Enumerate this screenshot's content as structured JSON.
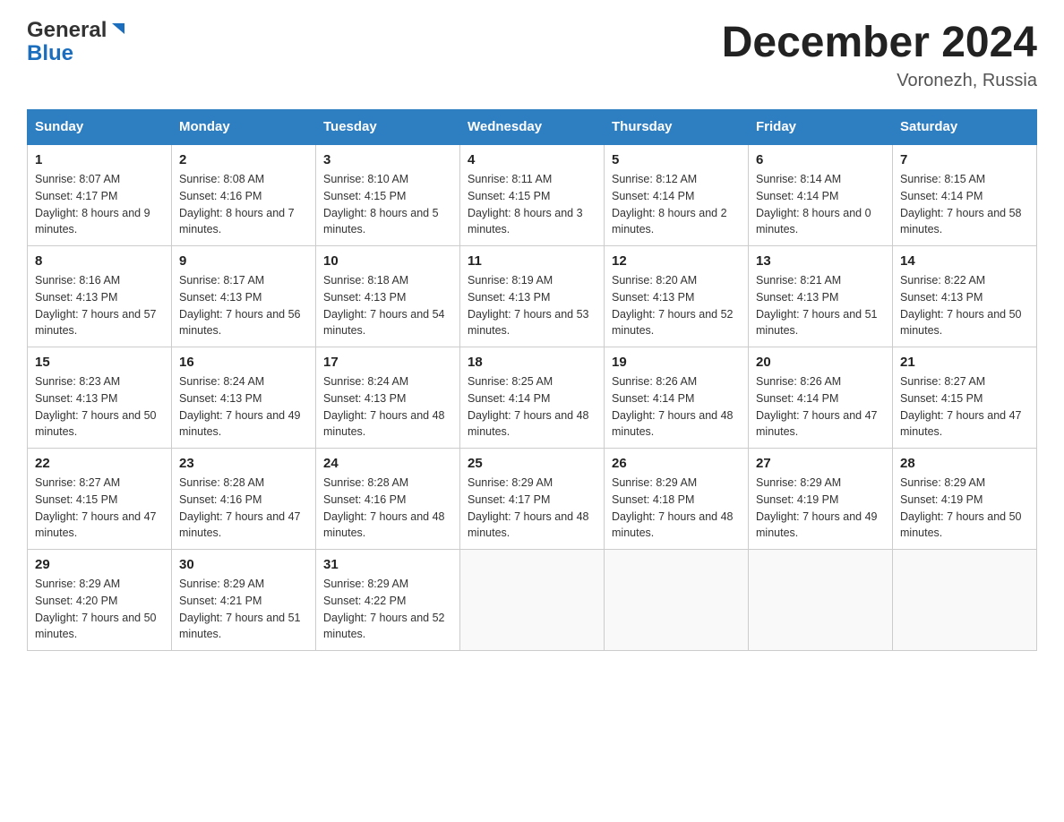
{
  "header": {
    "logo_line1": "General",
    "logo_line2": "Blue",
    "title": "December 2024",
    "subtitle": "Voronezh, Russia"
  },
  "days_of_week": [
    "Sunday",
    "Monday",
    "Tuesday",
    "Wednesday",
    "Thursday",
    "Friday",
    "Saturday"
  ],
  "weeks": [
    [
      {
        "day": "1",
        "sunrise": "Sunrise: 8:07 AM",
        "sunset": "Sunset: 4:17 PM",
        "daylight": "Daylight: 8 hours and 9 minutes."
      },
      {
        "day": "2",
        "sunrise": "Sunrise: 8:08 AM",
        "sunset": "Sunset: 4:16 PM",
        "daylight": "Daylight: 8 hours and 7 minutes."
      },
      {
        "day": "3",
        "sunrise": "Sunrise: 8:10 AM",
        "sunset": "Sunset: 4:15 PM",
        "daylight": "Daylight: 8 hours and 5 minutes."
      },
      {
        "day": "4",
        "sunrise": "Sunrise: 8:11 AM",
        "sunset": "Sunset: 4:15 PM",
        "daylight": "Daylight: 8 hours and 3 minutes."
      },
      {
        "day": "5",
        "sunrise": "Sunrise: 8:12 AM",
        "sunset": "Sunset: 4:14 PM",
        "daylight": "Daylight: 8 hours and 2 minutes."
      },
      {
        "day": "6",
        "sunrise": "Sunrise: 8:14 AM",
        "sunset": "Sunset: 4:14 PM",
        "daylight": "Daylight: 8 hours and 0 minutes."
      },
      {
        "day": "7",
        "sunrise": "Sunrise: 8:15 AM",
        "sunset": "Sunset: 4:14 PM",
        "daylight": "Daylight: 7 hours and 58 minutes."
      }
    ],
    [
      {
        "day": "8",
        "sunrise": "Sunrise: 8:16 AM",
        "sunset": "Sunset: 4:13 PM",
        "daylight": "Daylight: 7 hours and 57 minutes."
      },
      {
        "day": "9",
        "sunrise": "Sunrise: 8:17 AM",
        "sunset": "Sunset: 4:13 PM",
        "daylight": "Daylight: 7 hours and 56 minutes."
      },
      {
        "day": "10",
        "sunrise": "Sunrise: 8:18 AM",
        "sunset": "Sunset: 4:13 PM",
        "daylight": "Daylight: 7 hours and 54 minutes."
      },
      {
        "day": "11",
        "sunrise": "Sunrise: 8:19 AM",
        "sunset": "Sunset: 4:13 PM",
        "daylight": "Daylight: 7 hours and 53 minutes."
      },
      {
        "day": "12",
        "sunrise": "Sunrise: 8:20 AM",
        "sunset": "Sunset: 4:13 PM",
        "daylight": "Daylight: 7 hours and 52 minutes."
      },
      {
        "day": "13",
        "sunrise": "Sunrise: 8:21 AM",
        "sunset": "Sunset: 4:13 PM",
        "daylight": "Daylight: 7 hours and 51 minutes."
      },
      {
        "day": "14",
        "sunrise": "Sunrise: 8:22 AM",
        "sunset": "Sunset: 4:13 PM",
        "daylight": "Daylight: 7 hours and 50 minutes."
      }
    ],
    [
      {
        "day": "15",
        "sunrise": "Sunrise: 8:23 AM",
        "sunset": "Sunset: 4:13 PM",
        "daylight": "Daylight: 7 hours and 50 minutes."
      },
      {
        "day": "16",
        "sunrise": "Sunrise: 8:24 AM",
        "sunset": "Sunset: 4:13 PM",
        "daylight": "Daylight: 7 hours and 49 minutes."
      },
      {
        "day": "17",
        "sunrise": "Sunrise: 8:24 AM",
        "sunset": "Sunset: 4:13 PM",
        "daylight": "Daylight: 7 hours and 48 minutes."
      },
      {
        "day": "18",
        "sunrise": "Sunrise: 8:25 AM",
        "sunset": "Sunset: 4:14 PM",
        "daylight": "Daylight: 7 hours and 48 minutes."
      },
      {
        "day": "19",
        "sunrise": "Sunrise: 8:26 AM",
        "sunset": "Sunset: 4:14 PM",
        "daylight": "Daylight: 7 hours and 48 minutes."
      },
      {
        "day": "20",
        "sunrise": "Sunrise: 8:26 AM",
        "sunset": "Sunset: 4:14 PM",
        "daylight": "Daylight: 7 hours and 47 minutes."
      },
      {
        "day": "21",
        "sunrise": "Sunrise: 8:27 AM",
        "sunset": "Sunset: 4:15 PM",
        "daylight": "Daylight: 7 hours and 47 minutes."
      }
    ],
    [
      {
        "day": "22",
        "sunrise": "Sunrise: 8:27 AM",
        "sunset": "Sunset: 4:15 PM",
        "daylight": "Daylight: 7 hours and 47 minutes."
      },
      {
        "day": "23",
        "sunrise": "Sunrise: 8:28 AM",
        "sunset": "Sunset: 4:16 PM",
        "daylight": "Daylight: 7 hours and 47 minutes."
      },
      {
        "day": "24",
        "sunrise": "Sunrise: 8:28 AM",
        "sunset": "Sunset: 4:16 PM",
        "daylight": "Daylight: 7 hours and 48 minutes."
      },
      {
        "day": "25",
        "sunrise": "Sunrise: 8:29 AM",
        "sunset": "Sunset: 4:17 PM",
        "daylight": "Daylight: 7 hours and 48 minutes."
      },
      {
        "day": "26",
        "sunrise": "Sunrise: 8:29 AM",
        "sunset": "Sunset: 4:18 PM",
        "daylight": "Daylight: 7 hours and 48 minutes."
      },
      {
        "day": "27",
        "sunrise": "Sunrise: 8:29 AM",
        "sunset": "Sunset: 4:19 PM",
        "daylight": "Daylight: 7 hours and 49 minutes."
      },
      {
        "day": "28",
        "sunrise": "Sunrise: 8:29 AM",
        "sunset": "Sunset: 4:19 PM",
        "daylight": "Daylight: 7 hours and 50 minutes."
      }
    ],
    [
      {
        "day": "29",
        "sunrise": "Sunrise: 8:29 AM",
        "sunset": "Sunset: 4:20 PM",
        "daylight": "Daylight: 7 hours and 50 minutes."
      },
      {
        "day": "30",
        "sunrise": "Sunrise: 8:29 AM",
        "sunset": "Sunset: 4:21 PM",
        "daylight": "Daylight: 7 hours and 51 minutes."
      },
      {
        "day": "31",
        "sunrise": "Sunrise: 8:29 AM",
        "sunset": "Sunset: 4:22 PM",
        "daylight": "Daylight: 7 hours and 52 minutes."
      },
      null,
      null,
      null,
      null
    ]
  ]
}
